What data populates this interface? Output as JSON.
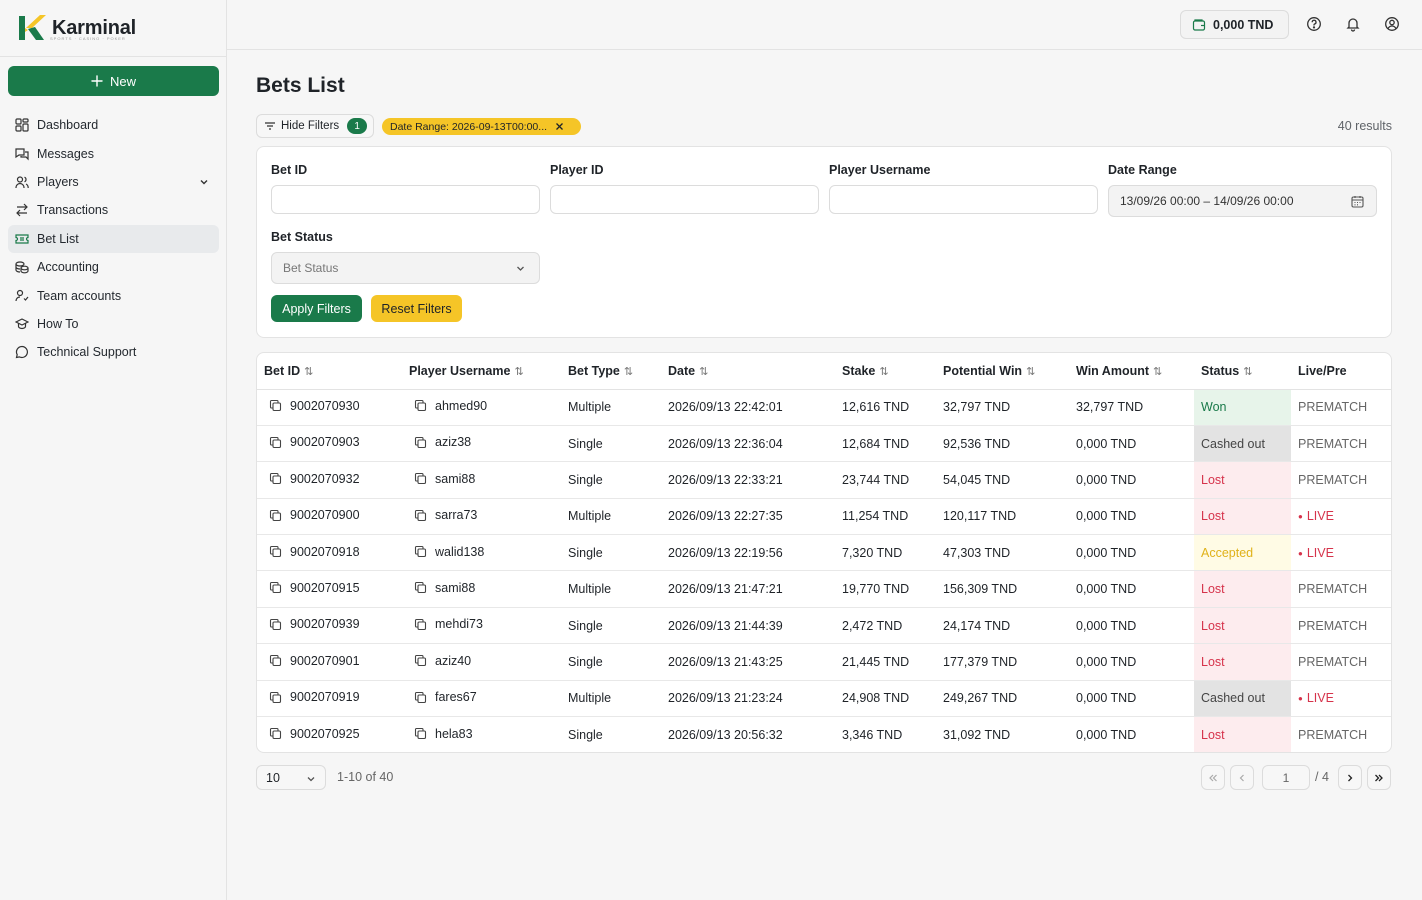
{
  "brand": {
    "name": "Karminal",
    "tagline": "SPORTS · CASINO · POKER"
  },
  "sidebar": {
    "new_label": "New",
    "items": [
      {
        "label": "Dashboard"
      },
      {
        "label": "Messages"
      },
      {
        "label": "Players"
      },
      {
        "label": "Transactions"
      },
      {
        "label": "Bet List"
      },
      {
        "label": "Accounting"
      },
      {
        "label": "Team accounts"
      },
      {
        "label": "How To"
      },
      {
        "label": "Technical Support"
      }
    ]
  },
  "topbar": {
    "balance": "0,000 TND"
  },
  "page": {
    "title": "Bets List",
    "hide_filters_label": "Hide Filters",
    "active_filter_count": "1",
    "date_chip": "Date Range: 2026-09-13T00:00...",
    "results": "40 results"
  },
  "filters": {
    "bet_id_label": "Bet ID",
    "player_id_label": "Player ID",
    "player_username_label": "Player Username",
    "date_range_label": "Date Range",
    "date_range_value": "13/09/26 00:00 – 14/09/26 00:00",
    "bet_status_label": "Bet Status",
    "bet_status_placeholder": "Bet Status",
    "apply_label": "Apply Filters",
    "reset_label": "Reset Filters"
  },
  "table": {
    "headers": [
      "Bet ID",
      "Player Username",
      "Bet Type",
      "Date",
      "Stake",
      "Potential Win",
      "Win Amount",
      "Status",
      "Live/Pre"
    ],
    "rows": [
      {
        "bet_id": "9002070930",
        "user": "ahmed90",
        "type": "Multiple",
        "date": "2026/09/13 22:42:01",
        "stake": "12,616 TND",
        "potential": "32,797 TND",
        "win": "32,797 TND",
        "status": "Won",
        "mode": "PREMATCH"
      },
      {
        "bet_id": "9002070903",
        "user": "aziz38",
        "type": "Single",
        "date": "2026/09/13 22:36:04",
        "stake": "12,684 TND",
        "potential": "92,536 TND",
        "win": "0,000 TND",
        "status": "Cashed out",
        "mode": "PREMATCH"
      },
      {
        "bet_id": "9002070932",
        "user": "sami88",
        "type": "Single",
        "date": "2026/09/13 22:33:21",
        "stake": "23,744 TND",
        "potential": "54,045 TND",
        "win": "0,000 TND",
        "status": "Lost",
        "mode": "PREMATCH"
      },
      {
        "bet_id": "9002070900",
        "user": "sarra73",
        "type": "Multiple",
        "date": "2026/09/13 22:27:35",
        "stake": "11,254 TND",
        "potential": "120,117 TND",
        "win": "0,000 TND",
        "status": "Lost",
        "mode": "LIVE"
      },
      {
        "bet_id": "9002070918",
        "user": "walid138",
        "type": "Single",
        "date": "2026/09/13 22:19:56",
        "stake": "7,320 TND",
        "potential": "47,303 TND",
        "win": "0,000 TND",
        "status": "Accepted",
        "mode": "LIVE"
      },
      {
        "bet_id": "9002070915",
        "user": "sami88",
        "type": "Multiple",
        "date": "2026/09/13 21:47:21",
        "stake": "19,770 TND",
        "potential": "156,309 TND",
        "win": "0,000 TND",
        "status": "Lost",
        "mode": "PREMATCH"
      },
      {
        "bet_id": "9002070939",
        "user": "mehdi73",
        "type": "Single",
        "date": "2026/09/13 21:44:39",
        "stake": "2,472 TND",
        "potential": "24,174 TND",
        "win": "0,000 TND",
        "status": "Lost",
        "mode": "PREMATCH"
      },
      {
        "bet_id": "9002070901",
        "user": "aziz40",
        "type": "Single",
        "date": "2026/09/13 21:43:25",
        "stake": "21,445 TND",
        "potential": "177,379 TND",
        "win": "0,000 TND",
        "status": "Lost",
        "mode": "PREMATCH"
      },
      {
        "bet_id": "9002070919",
        "user": "fares67",
        "type": "Multiple",
        "date": "2026/09/13 21:23:24",
        "stake": "24,908 TND",
        "potential": "249,267 TND",
        "win": "0,000 TND",
        "status": "Cashed out",
        "mode": "LIVE"
      },
      {
        "bet_id": "9002070925",
        "user": "hela83",
        "type": "Single",
        "date": "2026/09/13 20:56:32",
        "stake": "3,346 TND",
        "potential": "31,092 TND",
        "win": "0,000 TND",
        "status": "Lost",
        "mode": "PREMATCH"
      }
    ]
  },
  "pagination": {
    "per_page": "10",
    "range": "1-10 of 40",
    "current_page": "1",
    "total_pages": "/ 4"
  },
  "colors": {
    "primary": "#1a7a4a",
    "accent": "#f5c527",
    "lost": "#d6334b",
    "won_bg": "#e7f4ea",
    "lost_bg": "#fdecee",
    "cashed_bg": "#e3e3e3",
    "accepted_bg": "#fffbe5"
  }
}
